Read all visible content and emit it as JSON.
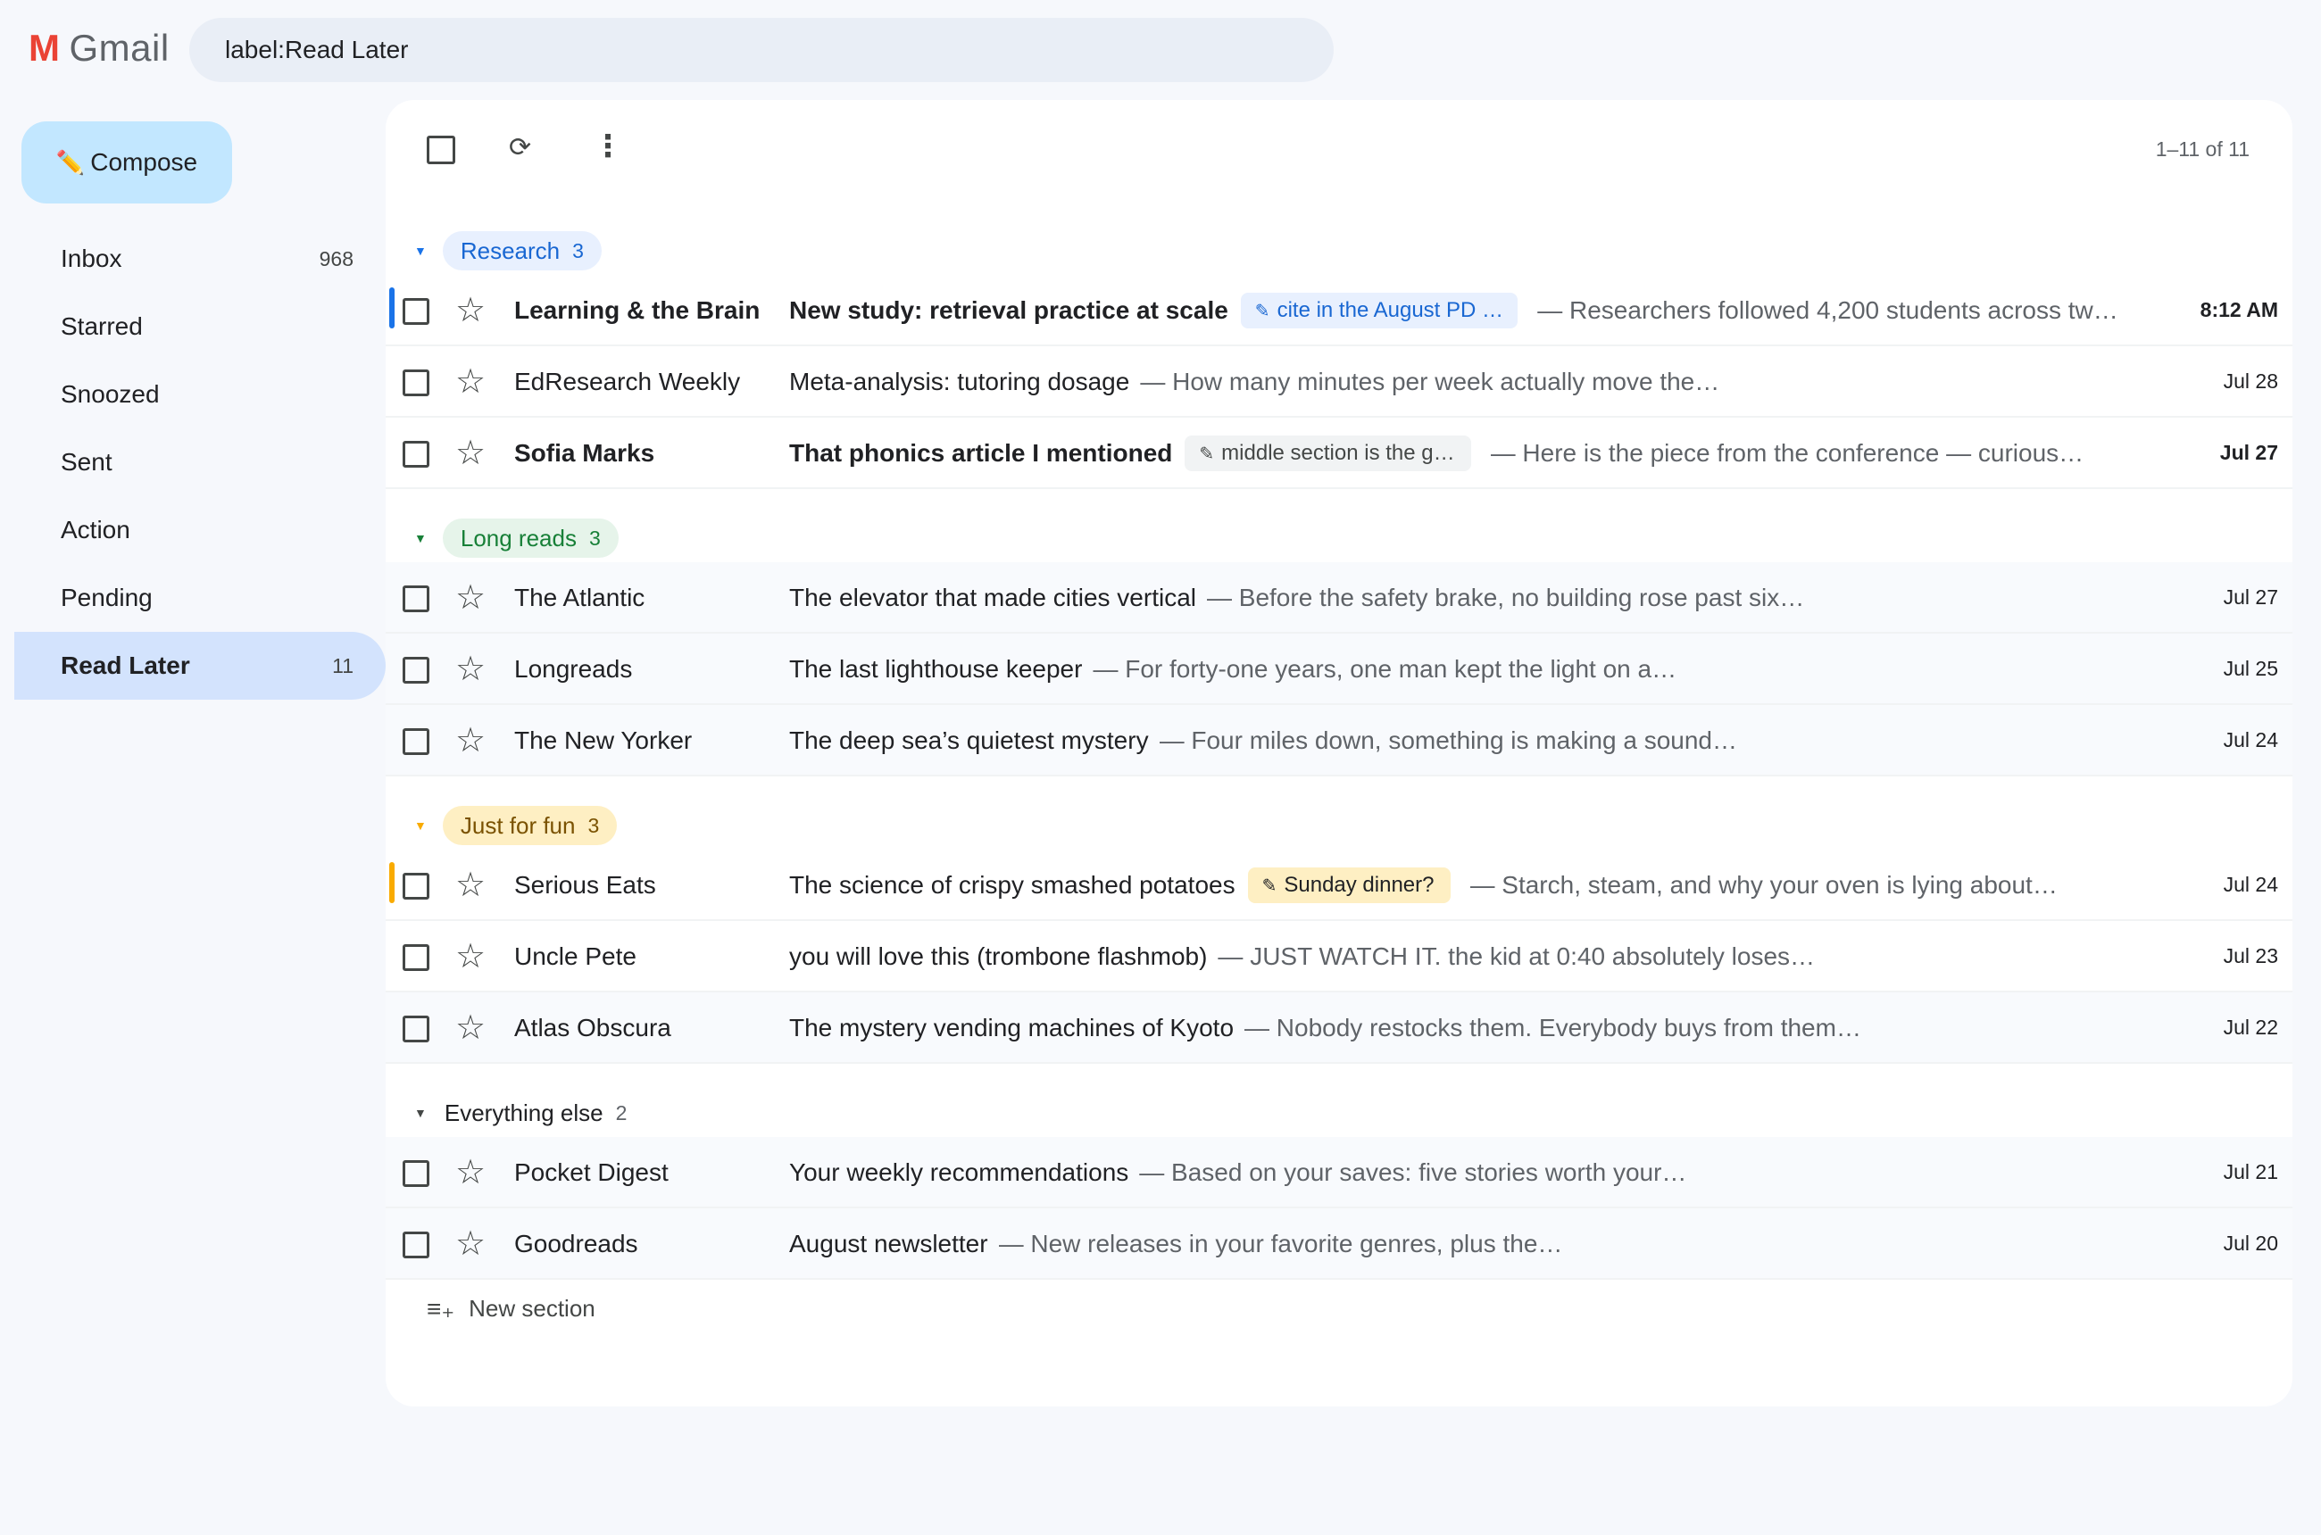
{
  "app": {
    "logo_mark": "M",
    "logo_text": "Gmail"
  },
  "search": {
    "value": "label:Read Later"
  },
  "compose": {
    "icon": "✏️",
    "label": "Compose"
  },
  "sidebar": {
    "items": [
      {
        "label": "Inbox",
        "count": "968"
      },
      {
        "label": "Starred",
        "count": ""
      },
      {
        "label": "Snoozed",
        "count": ""
      },
      {
        "label": "Sent",
        "count": ""
      },
      {
        "label": "Action",
        "count": ""
      },
      {
        "label": "Pending",
        "count": ""
      },
      {
        "label": "Read Later",
        "count": "11"
      }
    ]
  },
  "toolbar": {
    "refresh_icon": "⟳",
    "more_icon": "⋮",
    "range": "1–11 of 11"
  },
  "sections": [
    {
      "name": "Research",
      "count": "3",
      "bg": "#e8f0fe",
      "fg": "#1967d2",
      "accent": "#1a73e8"
    },
    {
      "name": "Long reads",
      "count": "3",
      "bg": "#e6f4ea",
      "fg": "#188038",
      "accent": "#188038"
    },
    {
      "name": "Just for fun",
      "count": "3",
      "bg": "#feefc3",
      "fg": "#7a5200",
      "accent": "#f9ab00"
    },
    {
      "name": "Everything else",
      "count": "2",
      "bg": "transparent",
      "fg": "#202124",
      "accent": "#444746"
    }
  ],
  "emails": [
    {
      "sender": "Learning & the Brain",
      "subject": "New study: retrieval practice at scale",
      "note": "cite in the August PD …",
      "note_bg": "#e8f0fe",
      "note_fg": "#1967d2",
      "snippet": "— Researchers followed 4,200 students across two…",
      "date": "8:12 AM",
      "unread": true,
      "bar": "#1a73e8"
    },
    {
      "sender": "EdResearch Weekly",
      "subject": "Meta-analysis: tutoring dosage",
      "note": "",
      "snippet": "— How many minutes per week actually move the…",
      "date": "Jul 28",
      "unread": false
    },
    {
      "sender": "Sofia Marks",
      "subject": "That phonics article I mentioned",
      "note": "middle section is the g…",
      "note_bg": "#f1f3f4",
      "note_fg": "#444746",
      "snippet": "— Here is the piece from the conference — curious…",
      "date": "Jul 27",
      "unread": true
    },
    {
      "sender": "The Atlantic",
      "subject": "The elevator that made cities vertical",
      "note": "",
      "snippet": "— Before the safety brake, no building rose past six…",
      "date": "Jul 27",
      "unread": false
    },
    {
      "sender": "Longreads",
      "subject": "The last lighthouse keeper",
      "note": "",
      "snippet": "— For forty-one years, one man kept the light on a…",
      "date": "Jul 25",
      "unread": false
    },
    {
      "sender": "The New Yorker",
      "subject": "The deep sea’s quietest mystery",
      "note": "",
      "snippet": "— Four miles down, something is making a sound…",
      "date": "Jul 24",
      "unread": false
    },
    {
      "sender": "Serious Eats",
      "subject": "The science of crispy smashed potatoes",
      "note": "Sunday dinner?",
      "note_bg": "#feefc3",
      "note_fg": "#202124",
      "snippet": "— Starch, steam, and why your oven is lying about…",
      "date": "Jul 24",
      "unread": false,
      "bar": "#f9ab00"
    },
    {
      "sender": "Uncle Pete",
      "subject": "you will love this (trombone flashmob)",
      "note": "",
      "snippet": "— JUST WATCH IT. the kid at 0:40 absolutely loses…",
      "date": "Jul 23",
      "unread": false
    },
    {
      "sender": "Atlas Obscura",
      "subject": "The mystery vending machines of Kyoto",
      "note": "",
      "snippet": "— Nobody restocks them. Everybody buys from them…",
      "date": "Jul 22",
      "unread": false
    },
    {
      "sender": "Pocket Digest",
      "subject": "Your weekly recommendations",
      "note": "",
      "snippet": "— Based on your saves: five stories worth your…",
      "date": "Jul 21",
      "unread": false
    },
    {
      "sender": "Goodreads",
      "subject": "August newsletter",
      "note": "",
      "snippet": "— New releases in your favorite genres, plus the…",
      "date": "Jul 20",
      "unread": false
    }
  ],
  "new_section": {
    "label": "New section"
  }
}
